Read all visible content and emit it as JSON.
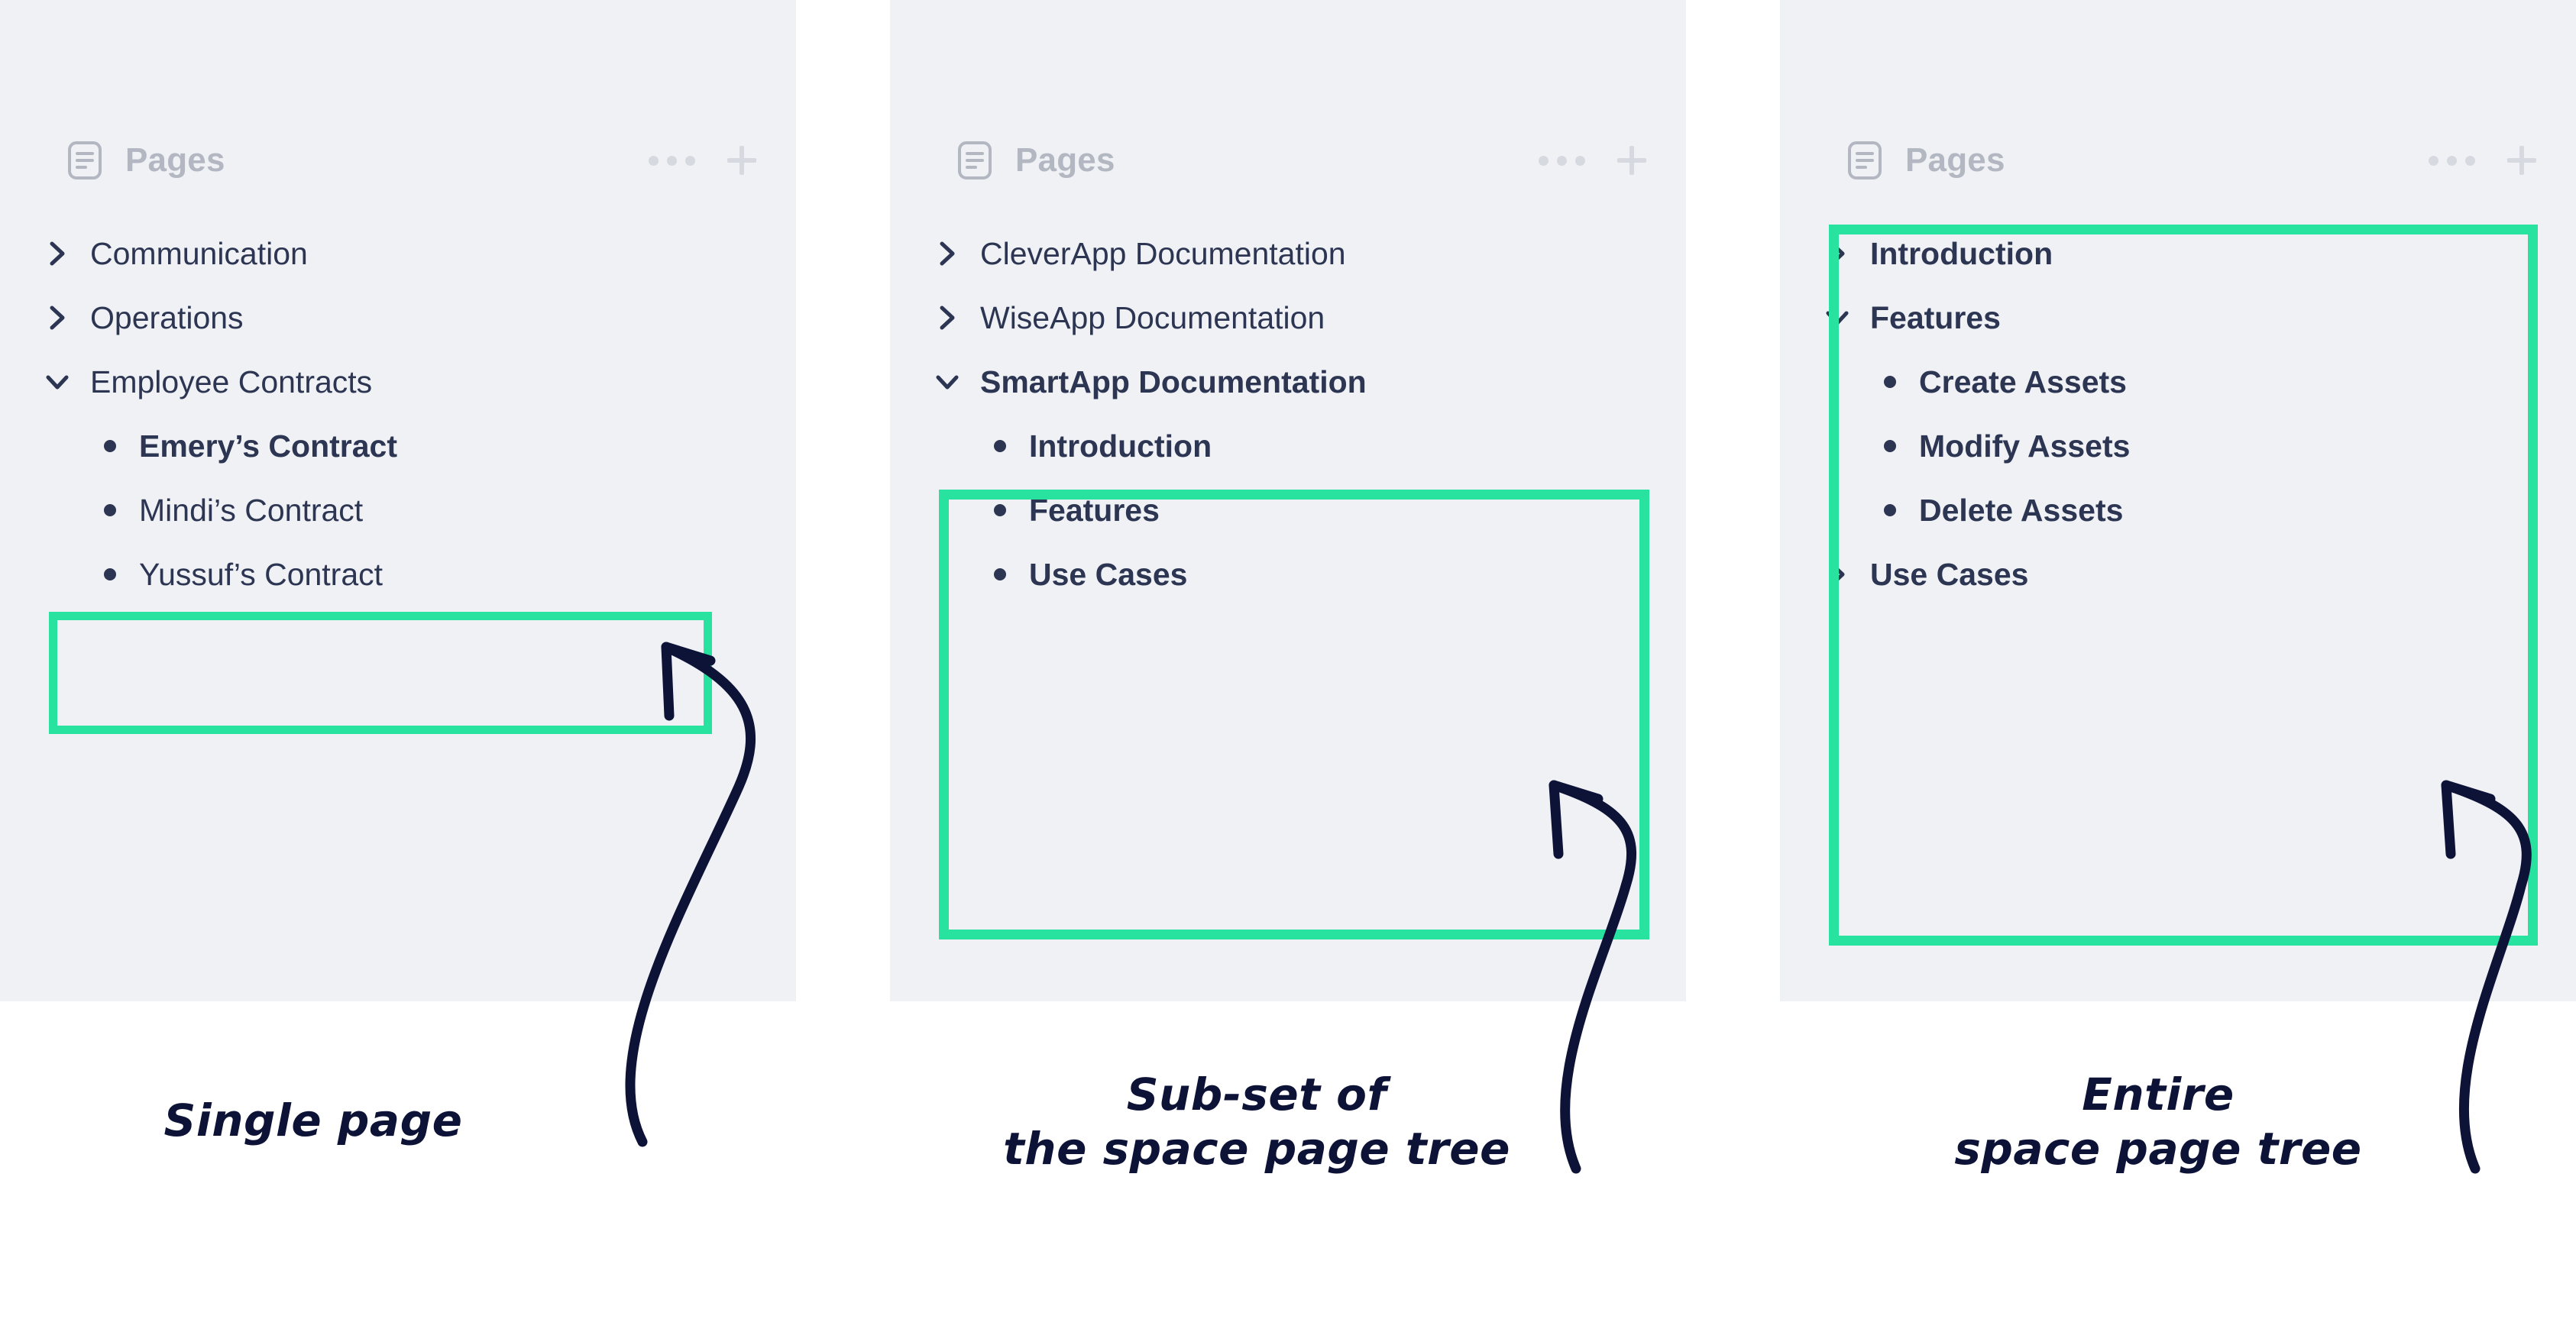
{
  "colors": {
    "panel_background": "#f0f1f5",
    "page_background": "#ffffff",
    "highlight_green": "#28e2a0",
    "text_navy": "#2c3552",
    "header_grey": "#b3b7c2",
    "annotation_navy": "#0d1237"
  },
  "panels": [
    {
      "header": {
        "icon": "pages-document-icon",
        "title": "Pages",
        "more_icon": "ellipsis-icon",
        "add_icon": "plus-icon"
      },
      "rows": [
        {
          "label": "Communication",
          "marker": "chevron-right",
          "indent": 0,
          "bold": false
        },
        {
          "label": "Operations",
          "marker": "chevron-right",
          "indent": 0,
          "bold": false
        },
        {
          "label": "Employee Contracts",
          "marker": "chevron-down",
          "indent": 0,
          "bold": false
        },
        {
          "label": "Emery’s Contract",
          "marker": "bullet",
          "indent": 1,
          "bold": true
        },
        {
          "label": "Mindi’s Contract",
          "marker": "bullet",
          "indent": 1,
          "bold": false
        },
        {
          "label": "Yussuf’s Contract",
          "marker": "bullet",
          "indent": 1,
          "bold": false
        }
      ],
      "caption": "Single page"
    },
    {
      "header": {
        "icon": "pages-document-icon",
        "title": "Pages",
        "more_icon": "ellipsis-icon",
        "add_icon": "plus-icon"
      },
      "rows": [
        {
          "label": "CleverApp Documentation",
          "marker": "chevron-right",
          "indent": 0,
          "bold": false
        },
        {
          "label": "WiseApp Documentation",
          "marker": "chevron-right",
          "indent": 0,
          "bold": false
        },
        {
          "label": "SmartApp Documentation",
          "marker": "chevron-down",
          "indent": 0,
          "bold": true
        },
        {
          "label": "Introduction",
          "marker": "bullet",
          "indent": 1,
          "bold": true
        },
        {
          "label": "Features",
          "marker": "bullet",
          "indent": 1,
          "bold": true
        },
        {
          "label": "Use Cases",
          "marker": "bullet",
          "indent": 1,
          "bold": true
        }
      ],
      "caption": "Sub-set of\nthe space page tree"
    },
    {
      "header": {
        "icon": "pages-document-icon",
        "title": "Pages",
        "more_icon": "ellipsis-icon",
        "add_icon": "plus-icon"
      },
      "rows": [
        {
          "label": "Introduction",
          "marker": "chevron-right",
          "indent": 0,
          "bold": true
        },
        {
          "label": "Features",
          "marker": "chevron-down",
          "indent": 0,
          "bold": true
        },
        {
          "label": "Create Assets",
          "marker": "bullet",
          "indent": 1,
          "bold": true
        },
        {
          "label": "Modify Assets",
          "marker": "bullet",
          "indent": 1,
          "bold": true
        },
        {
          "label": "Delete Assets",
          "marker": "bullet",
          "indent": 1,
          "bold": true
        },
        {
          "label": "Use Cases",
          "marker": "chevron-right",
          "indent": 0,
          "bold": true
        }
      ],
      "caption": "Entire\nspace page tree"
    }
  ]
}
